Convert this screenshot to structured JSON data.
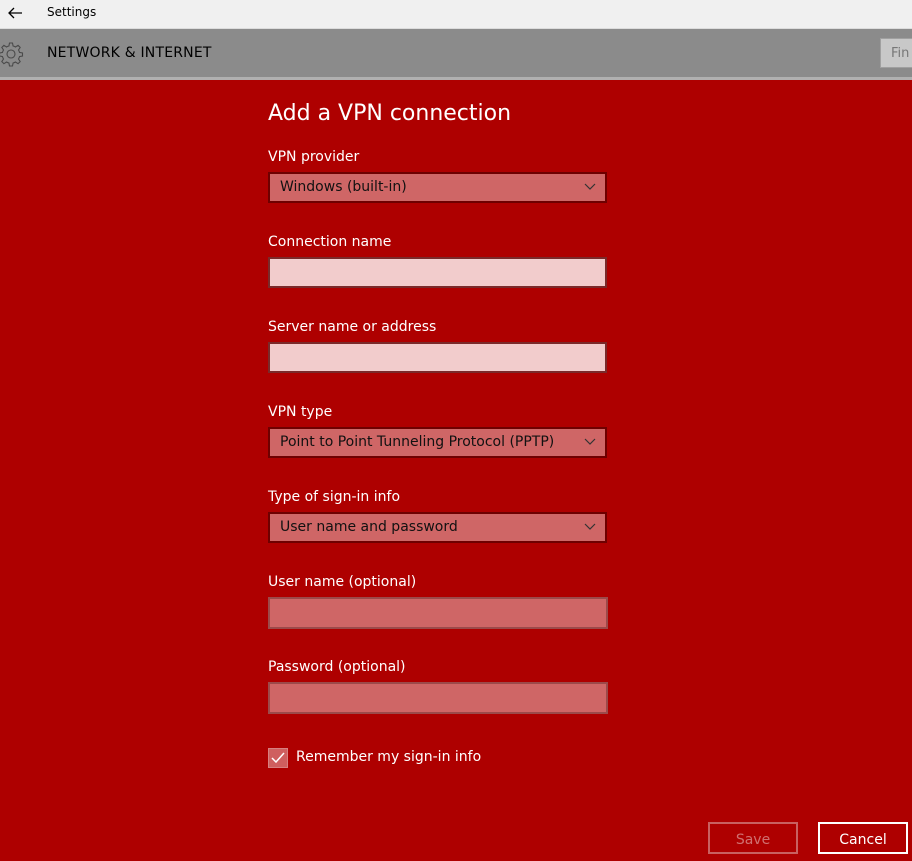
{
  "window": {
    "title": "Settings"
  },
  "header": {
    "section_title": "NETWORK & INTERNET",
    "search_placeholder": "Fin"
  },
  "form": {
    "heading": "Add a VPN connection",
    "vpn_provider": {
      "label": "VPN provider",
      "value": "Windows (built-in)"
    },
    "connection_name": {
      "label": "Connection name",
      "value": ""
    },
    "server_address": {
      "label": "Server name or address",
      "value": ""
    },
    "vpn_type": {
      "label": "VPN type",
      "value": "Point to Point Tunneling Protocol (PPTP)"
    },
    "signin_type": {
      "label": "Type of sign-in info",
      "value": "User name and password"
    },
    "username": {
      "label": "User name (optional)",
      "value": ""
    },
    "password": {
      "label": "Password (optional)",
      "value": ""
    },
    "remember": {
      "label": "Remember my sign-in info",
      "checked": true
    }
  },
  "buttons": {
    "save": "Save",
    "cancel": "Cancel"
  },
  "colors": {
    "accent_panel": "#ae0000",
    "header_bar": "#8b8b8b",
    "titlebar": "#f0f0f0"
  },
  "icons": {
    "back": "back-arrow-icon",
    "settings": "gear-icon",
    "dropdown": "chevron-down-icon",
    "check": "checkmark-icon"
  }
}
